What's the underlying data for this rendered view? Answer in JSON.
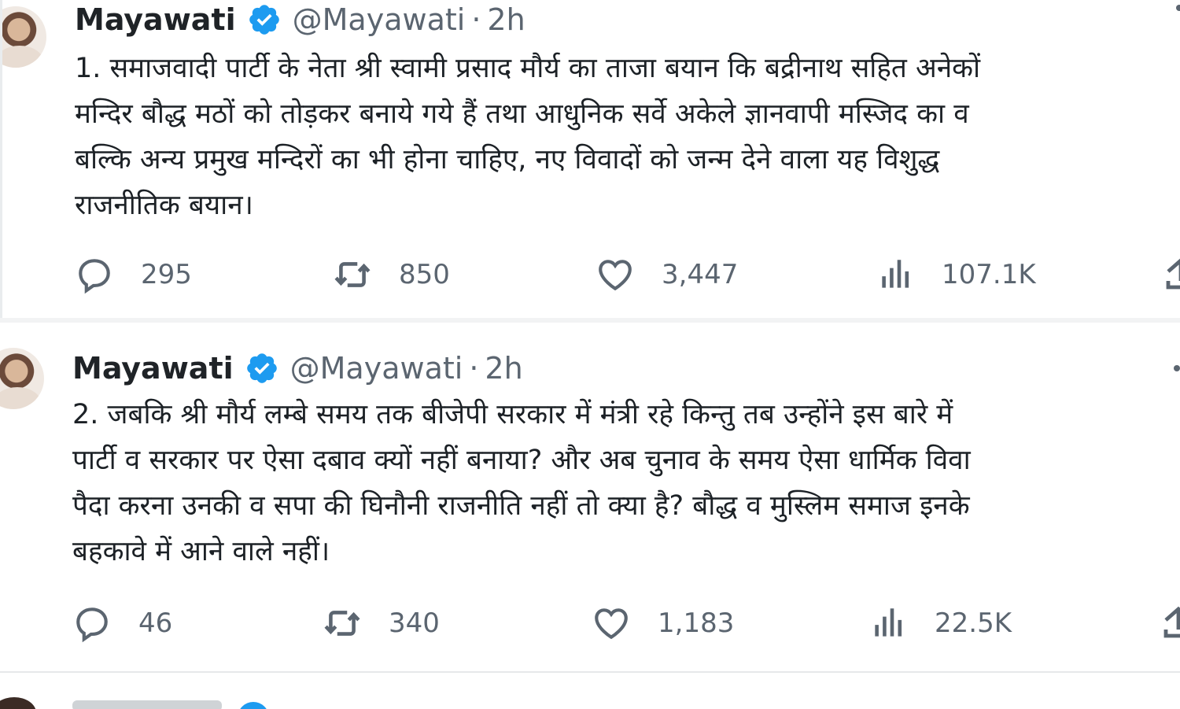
{
  "colors": {
    "text": "#0f1419",
    "secondary": "#5b6570",
    "verified": "#1d9bf0",
    "divider": "#e6e8ea"
  },
  "tweets": [
    {
      "author_name": "Mayawati",
      "handle": "@Mayawati",
      "separator": "·",
      "time": "2h",
      "lines": [
        "1. समाजवादी पार्टी के नेता श्री स्वामी प्रसाद मौर्य का ताजा बयान कि बद्रीनाथ सहित अनेकों",
        "मन्दिर बौद्ध मठों को तोड़कर बनाये गये हैं तथा आधुनिक सर्वे अकेले ज्ञानवापी मस्जिद का व",
        "बल्कि अन्य प्रमुख मन्दिरों का भी होना चाहिए, नए विवादों को जन्म देने वाला यह विशुद्ध",
        "राजनीतिक बयान।"
      ],
      "replies": "295",
      "retweets": "850",
      "likes": "3,447",
      "views": "107.1K"
    },
    {
      "author_name": "Mayawati",
      "handle": "@Mayawati",
      "separator": "·",
      "time": "2h",
      "lines": [
        "2. जबकि श्री मौर्य लम्बे समय तक बीजेपी सरकार में मंत्री रहे किन्तु तब उन्होंने इस बारे में",
        "पार्टी व सरकार पर ऐसा दबाव क्यों नहीं बनाया? और अब चुनाव के समय ऐसा धार्मिक विवा",
        "पैदा करना उनकी व सपा की घिनौनी राजनीति नहीं तो क्या है? बौद्ध व मुस्लिम समाज इनके",
        "बहकावे में आने वाले नहीं।"
      ],
      "replies": "46",
      "retweets": "340",
      "likes": "1,183",
      "views": "22.5K"
    }
  ]
}
